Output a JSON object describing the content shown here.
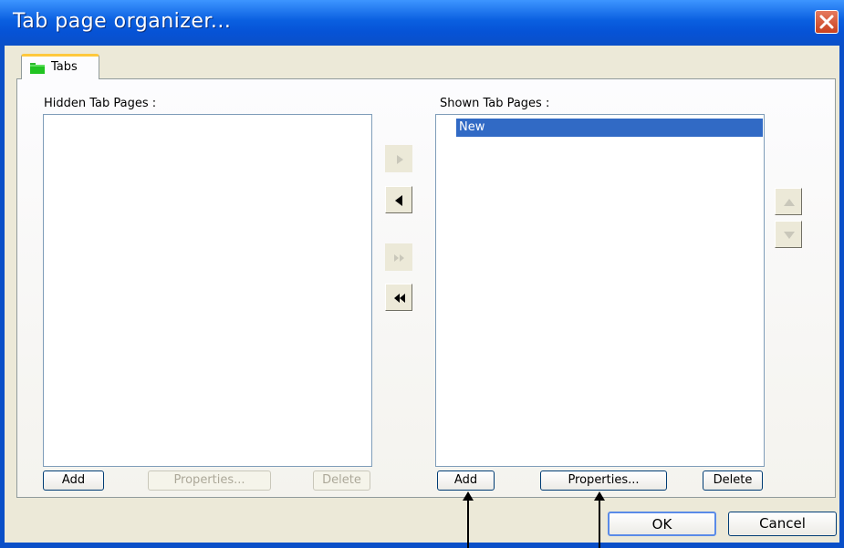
{
  "window": {
    "title": "Tab page organizer...",
    "close_icon": "close-x-icon"
  },
  "tabs": [
    {
      "label": "Tabs",
      "icon": "green-folder-icon",
      "active": true
    }
  ],
  "hidden_panel": {
    "label": "Hidden Tab Pages :",
    "items": [],
    "add_label": "Add",
    "properties_label": "Properties...",
    "delete_label": "Delete"
  },
  "shown_panel": {
    "label": "Shown Tab Pages :",
    "items": [
      "New"
    ],
    "selected_item": "New",
    "add_label": "Add",
    "properties_label": "Properties...",
    "delete_label": "Delete"
  },
  "move_buttons": {
    "move_right": "arrow-right-icon",
    "move_left": "arrow-left-icon",
    "move_all_right": "double-arrow-right-icon",
    "move_all_left": "double-arrow-left-icon",
    "move_up": "arrow-up-icon",
    "move_down": "arrow-down-icon"
  },
  "dialog_buttons": {
    "ok_label": "OK",
    "cancel_label": "Cancel"
  },
  "colors": {
    "titlebar": "#0A5FE0",
    "selection": "#316AC5",
    "tab_highlight": "#FFC83C"
  }
}
